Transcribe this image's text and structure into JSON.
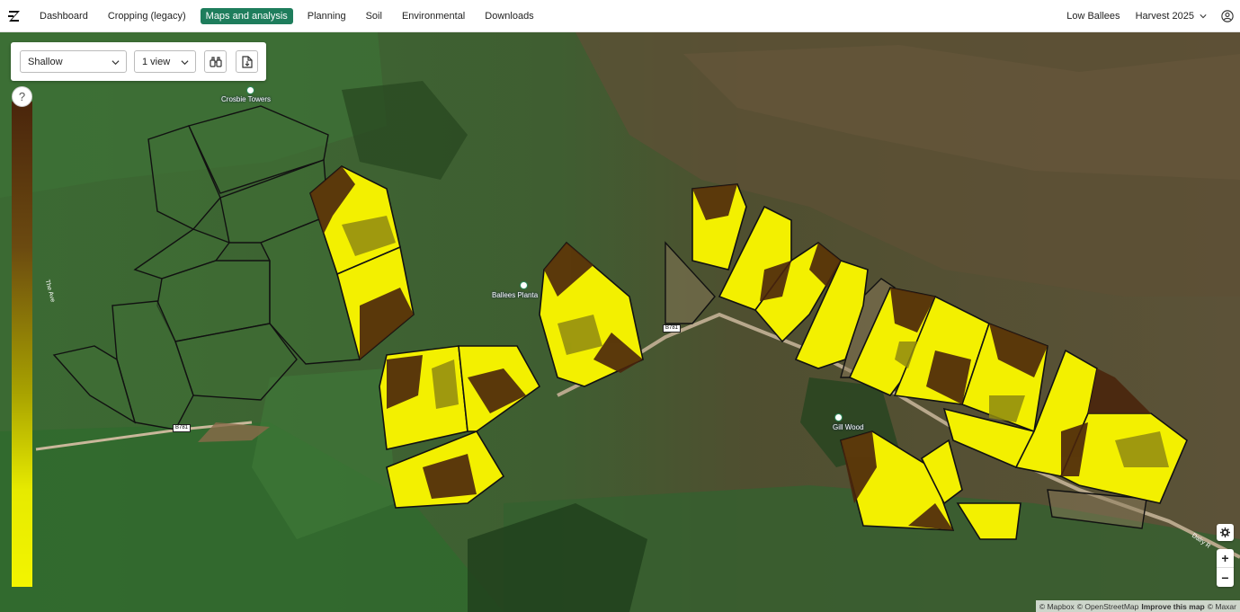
{
  "nav": {
    "items": [
      {
        "label": "Dashboard",
        "active": false
      },
      {
        "label": "Cropping (legacy)",
        "active": false
      },
      {
        "label": "Maps and analysis",
        "active": true
      },
      {
        "label": "Planning",
        "active": false
      },
      {
        "label": "Soil",
        "active": false
      },
      {
        "label": "Environmental",
        "active": false
      },
      {
        "label": "Downloads",
        "active": false
      }
    ],
    "farm": "Low Ballees",
    "harvest": "Harvest 2025"
  },
  "toolbar": {
    "depth_value": "Shallow",
    "view_value": "1 view",
    "binoculars_icon": "binoculars-icon",
    "export_icon": "export-pdf-icon"
  },
  "legend": {
    "help_label": "?",
    "colors": {
      "high": "#4a250c",
      "low": "#f3f500"
    }
  },
  "map": {
    "places": [
      {
        "label": "Crosbie Towers"
      },
      {
        "label": "Ballees Planta"
      },
      {
        "label": "Gill Wood"
      }
    ],
    "roads": [
      {
        "label": "B781"
      },
      {
        "label": "B781"
      },
      {
        "label": "The Ave"
      },
      {
        "label": "Dalry R"
      }
    ],
    "controls": {
      "zoom_in": "+",
      "zoom_out": "−"
    },
    "attribution": {
      "mapbox": "© Mapbox",
      "osm": "© OpenStreetMap",
      "improve": "Improve this map",
      "maxar": "© Maxar"
    }
  },
  "colors": {
    "accent": "#1e7d5c",
    "field_outline": "#111111"
  }
}
